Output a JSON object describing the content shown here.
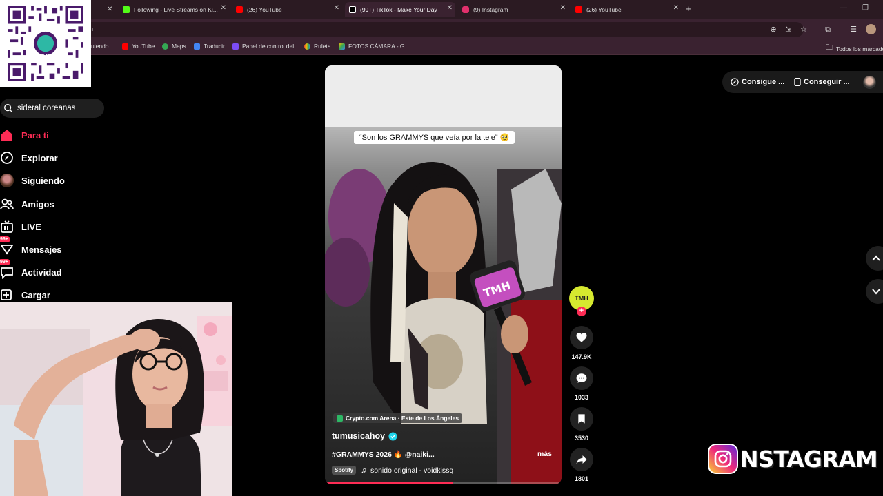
{
  "browser": {
    "tabs": [
      {
        "label": "Following - Live Streams on Ki...",
        "color": "#53fc18",
        "active": false
      },
      {
        "label": "(26) YouTube",
        "color": "#ff0000",
        "active": false
      },
      {
        "label": "(99+) TikTok - Make Your Day",
        "color": "#ffffff",
        "active": true
      },
      {
        "label": "(9) Instagram",
        "color": "#e1306c",
        "active": false
      },
      {
        "label": "(26) YouTube",
        "color": "#ff0000",
        "active": false
      }
    ],
    "address": "n",
    "bookmarks": [
      {
        "label": "uiendo...",
        "color": "#888888"
      },
      {
        "label": "YouTube",
        "color": "#ff0000"
      },
      {
        "label": "Maps",
        "color": "#34a853"
      },
      {
        "label": "Traducir",
        "color": "#4285f4"
      },
      {
        "label": "Panel de control del...",
        "color": "#7b4cf5"
      },
      {
        "label": "Ruleta",
        "color": "#f4b400"
      },
      {
        "label": "FOTOS CÁMARA - G...",
        "color": "#fbbc04"
      }
    ],
    "all_bookmarks": "Todos los marcado"
  },
  "sidebar": {
    "search_value": "sideral coreanas",
    "nav": [
      {
        "label": "Para ti",
        "icon": "home-icon",
        "active": true
      },
      {
        "label": "Explorar",
        "icon": "compass-icon"
      },
      {
        "label": "Siguiendo",
        "icon": "following-avatar"
      },
      {
        "label": "Amigos",
        "icon": "friends-icon"
      },
      {
        "label": "LIVE",
        "icon": "live-icon"
      },
      {
        "label": "Mensajes",
        "icon": "messages-icon",
        "badge": "99+"
      },
      {
        "label": "Actividad",
        "icon": "activity-icon",
        "badge": "99+"
      },
      {
        "label": "Cargar",
        "icon": "upload-icon"
      }
    ]
  },
  "qr": {
    "brand": "yape"
  },
  "video": {
    "caption": "“Son los GRAMMYS que veía por la tele” 🥹",
    "location": "Crypto.com Arena · Este de Los Ángeles",
    "username": "tumusicahoy",
    "description": "#GRAMMYS 2026 🔥 @naiki...",
    "more": "más",
    "spotify": "Spotify",
    "sound": "sonido original - voidkissq",
    "progress": 0.54,
    "mic_logo": "TMH"
  },
  "actions": {
    "creator_logo": "TMH",
    "likes": "147.9K",
    "comments": "1033",
    "saves": "3530",
    "shares": "1801"
  },
  "header": {
    "get_coins": "Consigue ...",
    "get_app": "Conseguir ..."
  },
  "overlay": {
    "instagram_text": "NSTAGRAM"
  }
}
